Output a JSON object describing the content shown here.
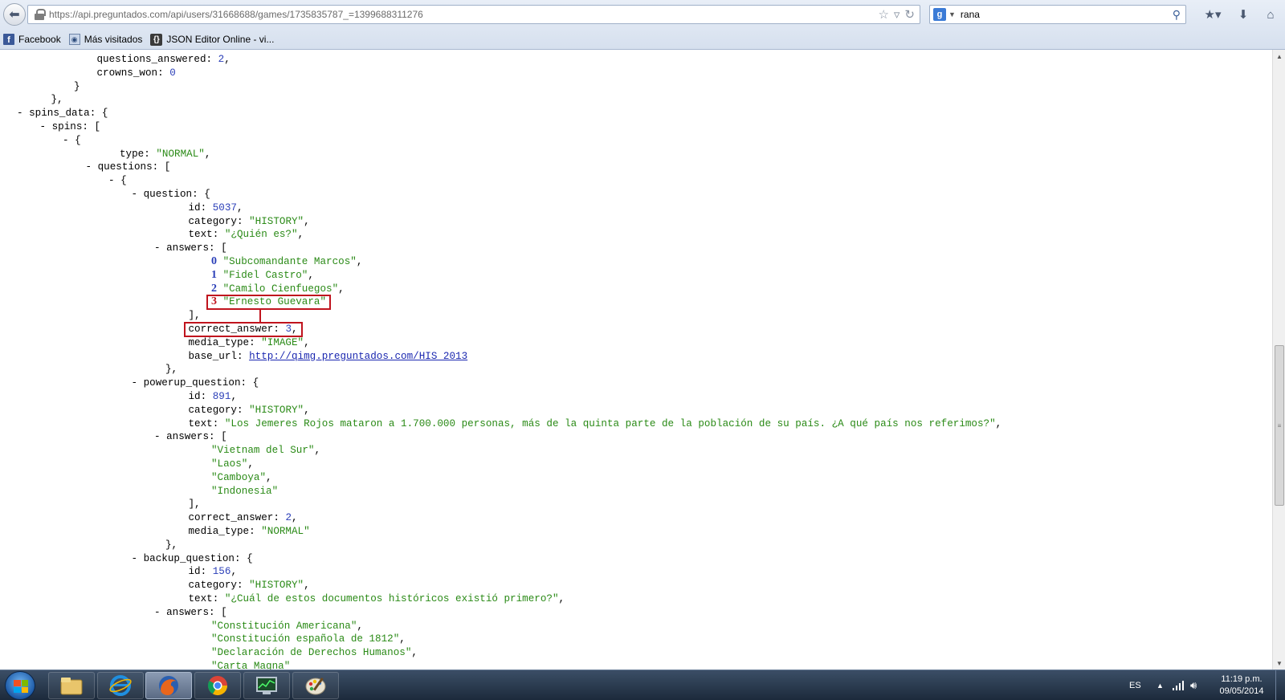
{
  "browser": {
    "url": "https://api.preguntados.com/api/users/31668688/games/1735835787_=1399688311276",
    "search_value": "rana",
    "search_engine_icon": "google-icon",
    "bookmarks": [
      {
        "label": "Facebook",
        "icon": "facebook-icon"
      },
      {
        "label": "Más visitados",
        "icon": "most-visited-icon"
      },
      {
        "label": "JSON Editor Online - vi...",
        "icon": "json-editor-icon"
      }
    ]
  },
  "json_lines": [
    {
      "indent": 3,
      "key": "questions_answered",
      "value": "2",
      "vtype": "num",
      "trail": ","
    },
    {
      "indent": 3,
      "key": "crowns_won",
      "value": "0",
      "vtype": "num",
      "trail": ""
    },
    {
      "indent": 2,
      "punct": "}"
    },
    {
      "indent": 1,
      "punct": "},"
    },
    {
      "indent": 0,
      "toggle": "-",
      "key": "spins_data",
      "open": "{"
    },
    {
      "indent": 1,
      "toggle": "-",
      "key": "spins",
      "open": "["
    },
    {
      "indent": 2,
      "toggle": "-",
      "open": "{"
    },
    {
      "indent": 4,
      "key": "type",
      "value": "\"NORMAL\"",
      "vtype": "str",
      "trail": ","
    },
    {
      "indent": 3,
      "toggle": "-",
      "key": "questions",
      "open": "["
    },
    {
      "indent": 4,
      "toggle": "-",
      "open": "{"
    },
    {
      "indent": 5,
      "toggle": "-",
      "key": "question",
      "open": "{"
    },
    {
      "indent": 7,
      "key": "id",
      "value": "5037",
      "vtype": "num",
      "trail": ","
    },
    {
      "indent": 7,
      "key": "category",
      "value": "\"HISTORY\"",
      "vtype": "str",
      "trail": ","
    },
    {
      "indent": 7,
      "key": "text",
      "value": "\"¿Quién es?\"",
      "vtype": "str",
      "trail": ","
    },
    {
      "indent": 6,
      "toggle": "-",
      "key": "answers",
      "open": "["
    },
    {
      "indent": 8,
      "index": "0",
      "value": "\"Subcomandante Marcos\"",
      "vtype": "str",
      "trail": ","
    },
    {
      "indent": 8,
      "index": "1",
      "value": "\"Fidel Castro\"",
      "vtype": "str",
      "trail": ","
    },
    {
      "indent": 8,
      "index": "2",
      "value": "\"Camilo Cienfuegos\"",
      "vtype": "str",
      "trail": ","
    },
    {
      "indent": 8,
      "index": "3",
      "value": "\"Ernesto Guevara\"",
      "vtype": "str",
      "trail": "",
      "highlight": true
    },
    {
      "indent": 7,
      "punct": "],"
    },
    {
      "indent": 7,
      "key": "correct_answer",
      "value": "3",
      "vtype": "num",
      "trail": ",",
      "highlight": true
    },
    {
      "indent": 7,
      "key": "media_type",
      "value": "\"IMAGE\"",
      "vtype": "str",
      "trail": ","
    },
    {
      "indent": 7,
      "key": "base_url",
      "value": "http://qimg.preguntados.com/HIS_2013",
      "vtype": "link",
      "trail": ""
    },
    {
      "indent": 6,
      "punct": "},"
    },
    {
      "indent": 5,
      "toggle": "-",
      "key": "powerup_question",
      "open": "{"
    },
    {
      "indent": 7,
      "key": "id",
      "value": "891",
      "vtype": "num",
      "trail": ","
    },
    {
      "indent": 7,
      "key": "category",
      "value": "\"HISTORY\"",
      "vtype": "str",
      "trail": ","
    },
    {
      "indent": 7,
      "key": "text",
      "value": "\"Los Jemeres Rojos mataron a 1.700.000 personas, más de la quinta parte de la población de su país. ¿A qué país nos referimos?\"",
      "vtype": "str",
      "trail": ","
    },
    {
      "indent": 6,
      "toggle": "-",
      "key": "answers",
      "open": "["
    },
    {
      "indent": 8,
      "value": "\"Vietnam del Sur\"",
      "vtype": "str",
      "trail": ","
    },
    {
      "indent": 8,
      "value": "\"Laos\"",
      "vtype": "str",
      "trail": ","
    },
    {
      "indent": 8,
      "value": "\"Camboya\"",
      "vtype": "str",
      "trail": ","
    },
    {
      "indent": 8,
      "value": "\"Indonesia\"",
      "vtype": "str",
      "trail": ""
    },
    {
      "indent": 7,
      "punct": "],"
    },
    {
      "indent": 7,
      "key": "correct_answer",
      "value": "2",
      "vtype": "num",
      "trail": ","
    },
    {
      "indent": 7,
      "key": "media_type",
      "value": "\"NORMAL\"",
      "vtype": "str",
      "trail": ""
    },
    {
      "indent": 6,
      "punct": "},"
    },
    {
      "indent": 5,
      "toggle": "-",
      "key": "backup_question",
      "open": "{"
    },
    {
      "indent": 7,
      "key": "id",
      "value": "156",
      "vtype": "num",
      "trail": ","
    },
    {
      "indent": 7,
      "key": "category",
      "value": "\"HISTORY\"",
      "vtype": "str",
      "trail": ","
    },
    {
      "indent": 7,
      "key": "text",
      "value": "\"¿Cuál de estos documentos históricos existió primero?\"",
      "vtype": "str",
      "trail": ","
    },
    {
      "indent": 6,
      "toggle": "-",
      "key": "answers",
      "open": "["
    },
    {
      "indent": 8,
      "value": "\"Constitución Americana\"",
      "vtype": "str",
      "trail": ","
    },
    {
      "indent": 8,
      "value": "\"Constitución española de 1812\"",
      "vtype": "str",
      "trail": ","
    },
    {
      "indent": 8,
      "value": "\"Declaración de Derechos Humanos\"",
      "vtype": "str",
      "trail": ","
    },
    {
      "indent": 8,
      "value": "\"Carta Magna\"",
      "vtype": "str",
      "trail": ""
    }
  ],
  "taskbar": {
    "apps": [
      {
        "name": "windows-explorer-icon",
        "state": "pinned"
      },
      {
        "name": "internet-explorer-icon",
        "state": "pinned"
      },
      {
        "name": "firefox-icon",
        "state": "active"
      },
      {
        "name": "chrome-icon",
        "state": "pinned"
      },
      {
        "name": "task-manager-icon",
        "state": "pinned"
      },
      {
        "name": "paint-icon",
        "state": "pinned"
      }
    ],
    "language": "ES",
    "time": "11:19 p.m.",
    "date": "09/05/2014"
  }
}
